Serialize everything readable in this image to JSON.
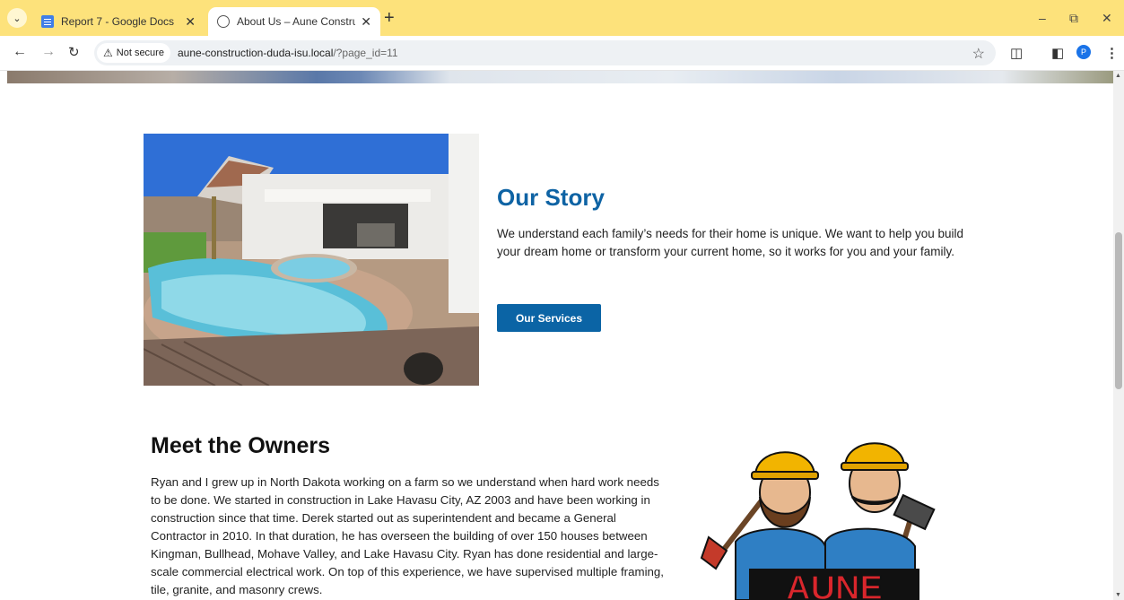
{
  "browser": {
    "tabs": [
      {
        "title": "Report 7 - Google Docs",
        "favicon": "google-docs-icon"
      },
      {
        "title": "About Us – Aune Construction",
        "favicon": "globe-icon",
        "active": true
      }
    ],
    "new_tab_symbol": "+",
    "address": {
      "security_label": "Not secure",
      "host": "aune-construction-duda-isu.local",
      "path": "/?page_id=11"
    },
    "profile_initial": "P"
  },
  "page": {
    "story": {
      "title": "Our Story",
      "text": "We understand each family’s needs for their home is unique.  We want to help you build your dream home or transform your current home, so it works for you and your family.",
      "button_label": "Our Services"
    },
    "owners": {
      "title": "Meet the Owners",
      "text": "Ryan and I grew up in North Dakota working on a farm so we understand when hard work needs to be done.  We started in construction in Lake Havasu City, AZ 2003 and have been working in construction since that time. Derek started out as superintendent and became a General Contractor in 2010.  In that duration, he has overseen the building of over 150 houses between Kingman, Bullhead, Mohave Valley, and Lake Havasu City.  Ryan has done residential and large-scale commercial electrical work.  On top of this experience, we have supervised multiple framing, tile, granite, and masonry crews.",
      "logo_text": "AUNE"
    }
  },
  "colors": {
    "chrome_yellow": "#fde27b",
    "brand_blue": "#0e63a4",
    "button_blue": "#0b64a5"
  }
}
